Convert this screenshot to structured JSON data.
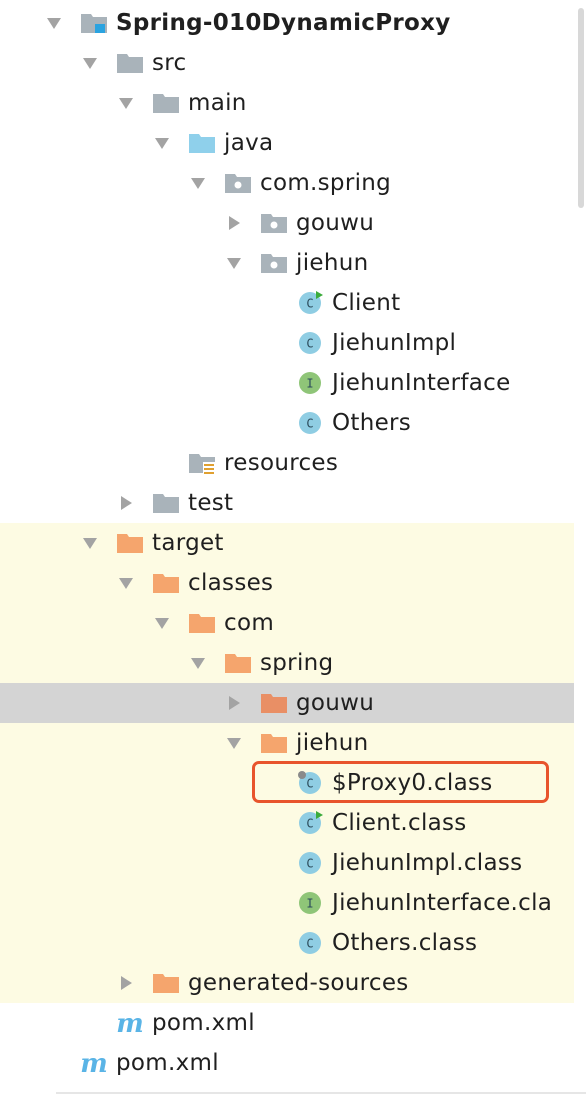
{
  "tree": [
    {
      "label": "Spring-010DynamicProxy",
      "depth": 0,
      "arrow": "down",
      "icon": "module-folder-icon",
      "bold": true,
      "bg": ""
    },
    {
      "label": "src",
      "depth": 1,
      "arrow": "down",
      "icon": "folder-gray-icon",
      "bg": ""
    },
    {
      "label": "main",
      "depth": 2,
      "arrow": "down",
      "icon": "folder-gray-icon",
      "bg": ""
    },
    {
      "label": "java",
      "depth": 3,
      "arrow": "down",
      "icon": "folder-source-icon",
      "bg": ""
    },
    {
      "label": "com.spring",
      "depth": 4,
      "arrow": "down",
      "icon": "package-icon",
      "bg": ""
    },
    {
      "label": "gouwu",
      "depth": 5,
      "arrow": "right",
      "icon": "package-icon",
      "bg": ""
    },
    {
      "label": "jiehun",
      "depth": 5,
      "arrow": "down",
      "icon": "package-icon",
      "bg": ""
    },
    {
      "label": "Client",
      "depth": 6,
      "arrow": "none",
      "icon": "class-runnable-icon",
      "bg": ""
    },
    {
      "label": "JiehunImpl",
      "depth": 6,
      "arrow": "none",
      "icon": "class-icon",
      "bg": ""
    },
    {
      "label": "JiehunInterface",
      "depth": 6,
      "arrow": "none",
      "icon": "interface-icon",
      "bg": ""
    },
    {
      "label": "Others",
      "depth": 6,
      "arrow": "none",
      "icon": "class-icon",
      "bg": ""
    },
    {
      "label": "resources",
      "depth": 3,
      "arrow": "none",
      "icon": "resources-folder-icon",
      "bg": ""
    },
    {
      "label": "test",
      "depth": 2,
      "arrow": "right",
      "icon": "folder-gray-icon",
      "bg": ""
    },
    {
      "label": "target",
      "depth": 1,
      "arrow": "down",
      "icon": "folder-orange-icon",
      "bg": "excluded"
    },
    {
      "label": "classes",
      "depth": 2,
      "arrow": "down",
      "icon": "folder-orange-icon",
      "bg": "excluded"
    },
    {
      "label": "com",
      "depth": 3,
      "arrow": "down",
      "icon": "folder-orange-icon",
      "bg": "excluded"
    },
    {
      "label": "spring",
      "depth": 4,
      "arrow": "down",
      "icon": "folder-orange-icon",
      "bg": "excluded"
    },
    {
      "label": "gouwu",
      "depth": 5,
      "arrow": "right",
      "icon": "folder-orange-icon",
      "bg": "selected"
    },
    {
      "label": "jiehun",
      "depth": 5,
      "arrow": "down",
      "icon": "folder-orange-icon",
      "bg": "excluded"
    },
    {
      "label": "$Proxy0.class",
      "depth": 6,
      "arrow": "none",
      "icon": "class-file-icon",
      "bg": "excluded",
      "highlighted": true
    },
    {
      "label": "Client.class",
      "depth": 6,
      "arrow": "none",
      "icon": "class-runnable-icon",
      "bg": "excluded"
    },
    {
      "label": "JiehunImpl.class",
      "depth": 6,
      "arrow": "none",
      "icon": "class-icon",
      "bg": "excluded"
    },
    {
      "label": "JiehunInterface.cla",
      "depth": 6,
      "arrow": "none",
      "icon": "interface-icon",
      "bg": "excluded"
    },
    {
      "label": "Others.class",
      "depth": 6,
      "arrow": "none",
      "icon": "class-icon",
      "bg": "excluded"
    },
    {
      "label": "generated-sources",
      "depth": 2,
      "arrow": "right",
      "icon": "folder-orange-icon",
      "bg": "excluded"
    },
    {
      "label": "pom.xml",
      "depth": 1,
      "arrow": "none",
      "icon": "maven-icon",
      "bg": ""
    },
    {
      "label": "pom.xml",
      "depth": 0,
      "arrow": "none",
      "icon": "maven-icon",
      "bg": ""
    }
  ],
  "colors": {
    "folder_gray": "#a9b3ba",
    "folder_source": "#8fd0eb",
    "folder_orange": "#f5a56d",
    "folder_orange_selected": "#e98f65",
    "class_blue": "#8fcde3",
    "interface_green": "#8fc578",
    "highlight_border": "#e8542c"
  }
}
